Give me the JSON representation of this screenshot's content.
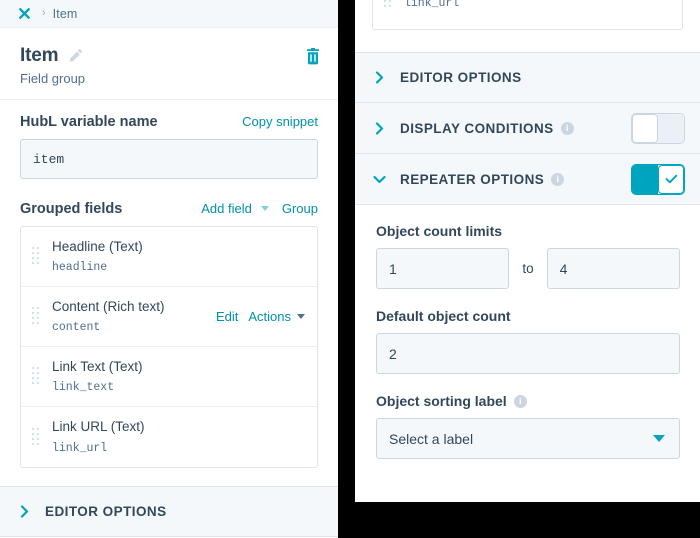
{
  "breadcrumb": {
    "close_icon": "close-x-icon",
    "separator": "›",
    "item": "Item"
  },
  "left_panel": {
    "title": "Item",
    "edit_icon": "pencil-icon",
    "delete_icon": "trash-icon",
    "subtitle": "Field group",
    "hubl": {
      "label": "HubL variable name",
      "copy_link": "Copy snippet",
      "value": "item"
    },
    "grouped": {
      "label": "Grouped fields",
      "add_field_link": "Add field",
      "group_link": "Group",
      "fields": [
        {
          "name": "Headline (Text)",
          "variable": "headline",
          "actions": []
        },
        {
          "name": "Content (Rich text)",
          "variable": "content",
          "actions": [
            "Edit",
            "Actions"
          ]
        },
        {
          "name": "Link Text (Text)",
          "variable": "link_text",
          "actions": []
        },
        {
          "name": "Link URL (Text)",
          "variable": "link_url",
          "actions": []
        }
      ]
    },
    "editor_options": {
      "title": "EDITOR OPTIONS",
      "chevron": "chevron-right-icon"
    }
  },
  "right_panel": {
    "partial_field_variable": "link_url",
    "sections": [
      {
        "title": "EDITOR OPTIONS",
        "expanded": false,
        "has_info": false,
        "has_toggle": false,
        "toggle_on": false
      },
      {
        "title": "DISPLAY CONDITIONS",
        "expanded": false,
        "has_info": true,
        "has_toggle": true,
        "toggle_on": false
      },
      {
        "title": "REPEATER OPTIONS",
        "expanded": true,
        "has_info": true,
        "has_toggle": true,
        "toggle_on": true
      }
    ],
    "repeater": {
      "count_limits_label": "Object count limits",
      "count_min": "1",
      "to_word": "to",
      "count_max": "4",
      "default_count_label": "Default object count",
      "default_count": "2",
      "sorting_label": "Object sorting label",
      "sorting_value": "Select a label"
    }
  },
  "colors": {
    "accent": "#00a4bd",
    "link": "#0091ae",
    "text": "#33475b",
    "muted": "#516f90",
    "panel_bg": "#f5f8fa",
    "border": "#dfe3eb"
  }
}
